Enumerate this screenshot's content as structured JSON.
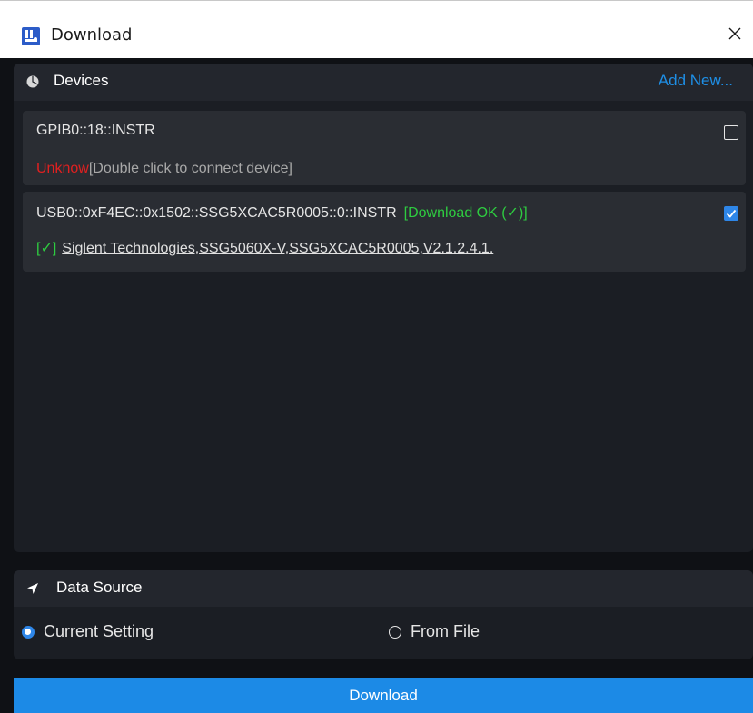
{
  "window": {
    "title": "Download",
    "icon": "instrument-app-icon",
    "close_icon": "close-icon"
  },
  "devices": {
    "title": "Devices",
    "add_new_label": "Add New...",
    "items": [
      {
        "name": "GPIB0::18::INSTR",
        "status_label": "Unknow",
        "hint": "[Double click to connect device]",
        "checked": false
      },
      {
        "name": "USB0::0xF4EC::0x1502::SSG5XCAC5R0005::0::INSTR",
        "download_status": "[Download OK (✓)]",
        "ok_mark": "[✓]",
        "idn": "Siglent Technologies,SSG5060X-V,SSG5XCAC5R0005,V2.1.2.4.1.",
        "checked": true
      }
    ]
  },
  "data_source": {
    "title": "Data Source",
    "options": [
      {
        "label": "Current Setting",
        "selected": true
      },
      {
        "label": "From File",
        "selected": false
      }
    ]
  },
  "actions": {
    "download_label": "Download"
  },
  "colors": {
    "accent": "#1c8ae6",
    "ok": "#2ecc40",
    "error": "#e02020",
    "panel": "#1b1e24"
  }
}
